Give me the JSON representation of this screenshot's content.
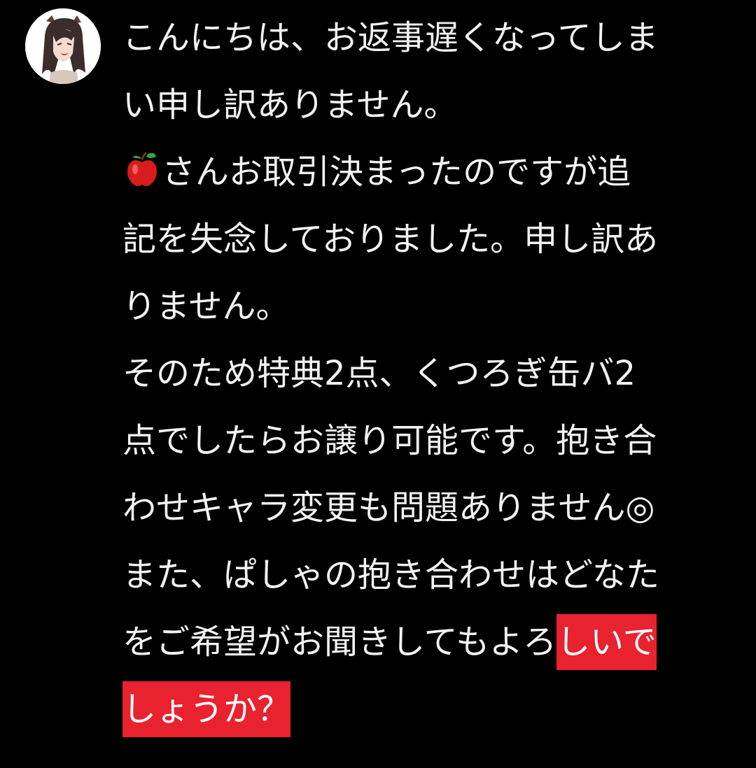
{
  "message": {
    "sender_avatar": "anime-character-avatar",
    "line_01": "こんにちは、お返事遅くなってしま",
    "line_02": "い申し訳ありません。",
    "line_03_icon": "red-apple-emoji",
    "line_03": "さんお取引決まったのですが追",
    "line_04": "記を失念しておりました。申し訳あ",
    "line_05": "りません。",
    "line_06": "そのため特典2点、くつろぎ缶バ2",
    "line_07": "点でしたらお譲り可能です。抱き合",
    "line_08": "わせキャラ変更も問題ありません◎",
    "line_09": "また、ぱしゃの抱き合わせはどなた",
    "line_10_plain": "をご希望がお聞きしてもよろ",
    "line_10_highlight": "しいで",
    "line_11_highlight": "しょうか？",
    "highlight_color": "#e8222f"
  }
}
